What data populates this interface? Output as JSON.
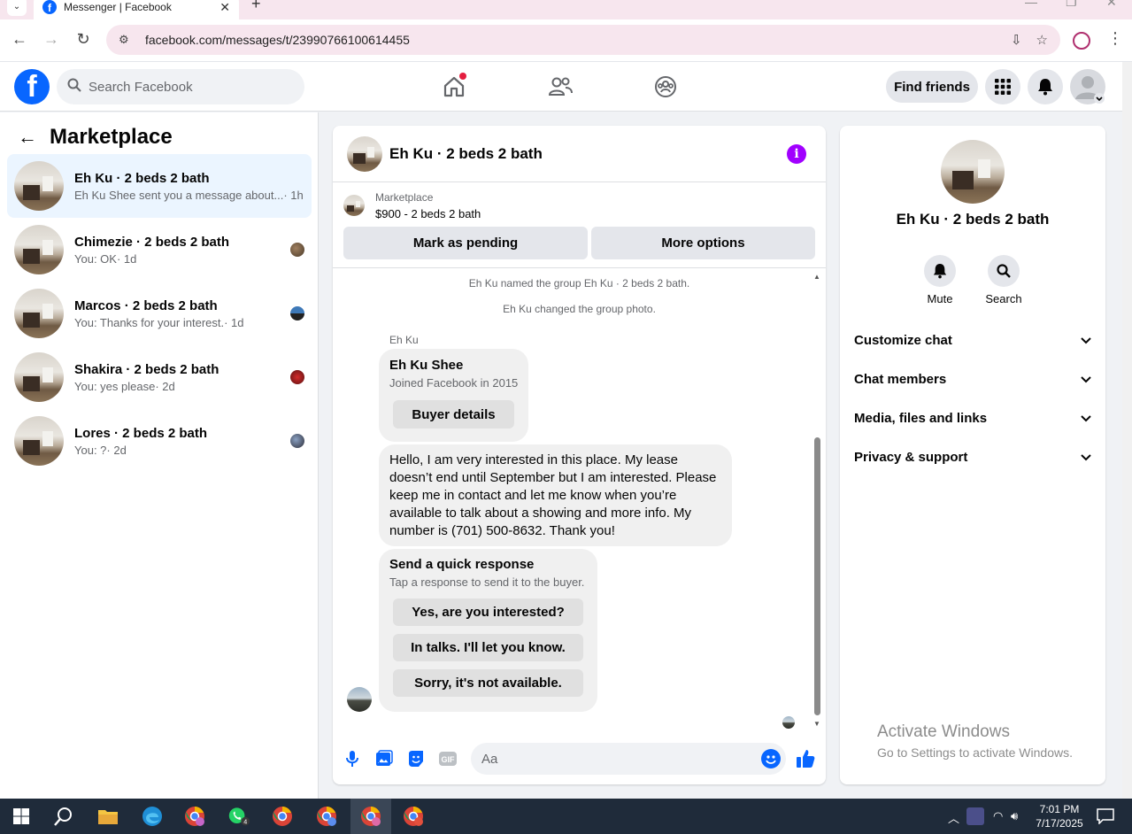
{
  "browser": {
    "tab_title": "Messenger | Facebook",
    "url": "facebook.com/messages/t/23990766100614455"
  },
  "header": {
    "search_placeholder": "Search Facebook",
    "find_friends": "Find friends"
  },
  "sidebar": {
    "title": "Marketplace",
    "conversations": [
      {
        "name": "Eh Ku · 2 beds 2 bath",
        "preview": "Eh Ku Shee sent you a message about...",
        "time": "· 1h"
      },
      {
        "name": "Chimezie · 2 beds 2 bath",
        "preview": "You: OK",
        "time": "· 1d"
      },
      {
        "name": "Marcos · 2 beds 2 bath",
        "preview": "You: Thanks for your interest.",
        "time": "· 1d"
      },
      {
        "name": "Shakira · 2 beds 2 bath",
        "preview": "You: yes please",
        "time": "· 2d"
      },
      {
        "name": "Lores · 2 beds 2 bath",
        "preview": "You: ?",
        "time": "· 2d"
      }
    ]
  },
  "chat": {
    "title": "Eh Ku · 2 beds 2 bath",
    "listing_source": "Marketplace",
    "listing_price": "$900 - 2 beds 2 bath",
    "mark_pending": "Mark as pending",
    "more_options": "More options",
    "system_messages": [
      "Eh Ku named the group Eh Ku · 2 beds 2 bath.",
      "Eh Ku changed the group photo."
    ],
    "sender_label": "Eh Ku",
    "buyer_card": {
      "name": "Eh Ku Shee",
      "joined": "Joined Facebook in 2015",
      "button": "Buyer details"
    },
    "message": "Hello, I am very interested in this place. My lease doesn’t end until September but I am interested. Please keep me in contact and let me know when you’re available to talk about a showing and more info. My number is (701) 500-8632. Thank you!",
    "quick_response": {
      "title": "Send a quick response",
      "subtitle": "Tap a response to send it to the buyer.",
      "options": [
        "Yes, are you interested?",
        "In talks. I'll let you know.",
        "Sorry, it's not available."
      ]
    },
    "composer_placeholder": "Aa"
  },
  "details": {
    "title": "Eh Ku · 2 beds 2 bath",
    "actions": [
      "Mute",
      "Search"
    ],
    "sections": [
      "Customize chat",
      "Chat members",
      "Media, files and links",
      "Privacy & support"
    ]
  },
  "watermark": {
    "line1": "Activate Windows",
    "line2": "Go to Settings to activate Windows."
  },
  "taskbar": {
    "whatsapp_badge": "4",
    "time": "7:01 PM",
    "date": "7/17/2025"
  },
  "colors": {
    "facebook_blue": "#0866ff",
    "info_purple": "#a100ff",
    "active_row": "#ebf5ff"
  }
}
